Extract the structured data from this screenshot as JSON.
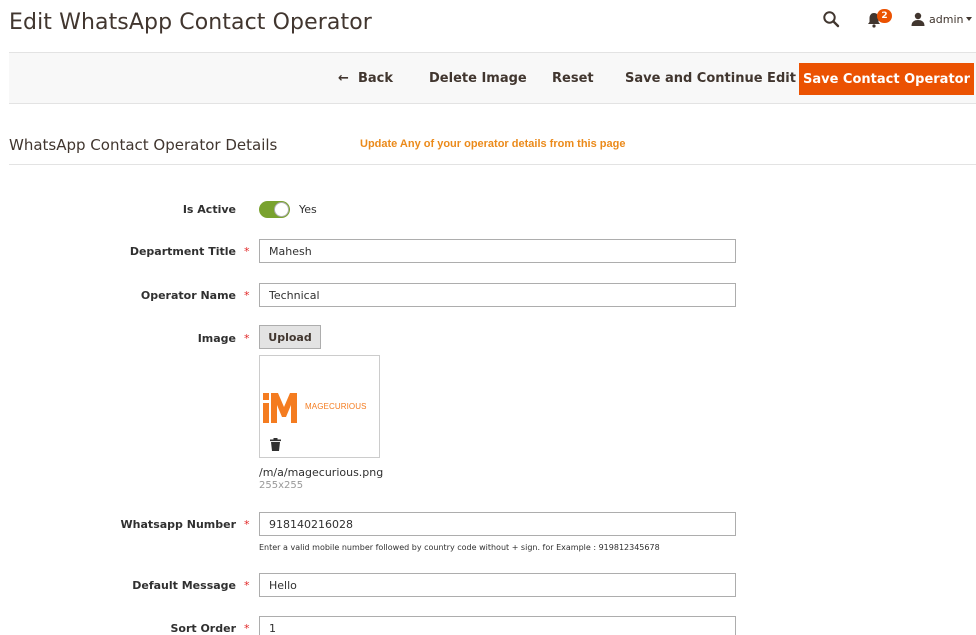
{
  "header": {
    "title": "Edit WhatsApp Contact Operator",
    "notification_count": "2",
    "user_name": "admin",
    "icons": {
      "search": "search-icon",
      "bell": "bell-icon",
      "user": "user-icon"
    }
  },
  "toolbar": {
    "back_label": "Back",
    "delete_image_label": "Delete Image",
    "reset_label": "Reset",
    "save_continue_label": "Save and Continue Edit",
    "save_label": "Save Contact Operator"
  },
  "section": {
    "title": "WhatsApp Contact Operator Details",
    "note": "Update Any of your operator details from this page"
  },
  "form": {
    "is_active": {
      "label": "Is Active",
      "value_text": "Yes",
      "checked": true
    },
    "department_title": {
      "label": "Department Title",
      "value": "Mahesh"
    },
    "operator_name": {
      "label": "Operator Name",
      "value": "Technical"
    },
    "image": {
      "label": "Image",
      "upload_label": "Upload",
      "logo_text": "MAGECURIOUS",
      "file_name": "/m/a/magecurious.png",
      "file_size": "255x255"
    },
    "whatsapp_number": {
      "label": "Whatsapp Number",
      "value": "918140216028",
      "note": "Enter a valid mobile number followed by country code without + sign. for Example : 919812345678"
    },
    "default_message": {
      "label": "Default Message",
      "value": "Hello"
    },
    "sort_order": {
      "label": "Sort Order",
      "value": "1"
    },
    "required_mark": "*"
  },
  "colors": {
    "accent": "#eb5202",
    "note_orange": "#eb8a1a",
    "toggle_on": "#79a22e",
    "required": "#e22626"
  }
}
